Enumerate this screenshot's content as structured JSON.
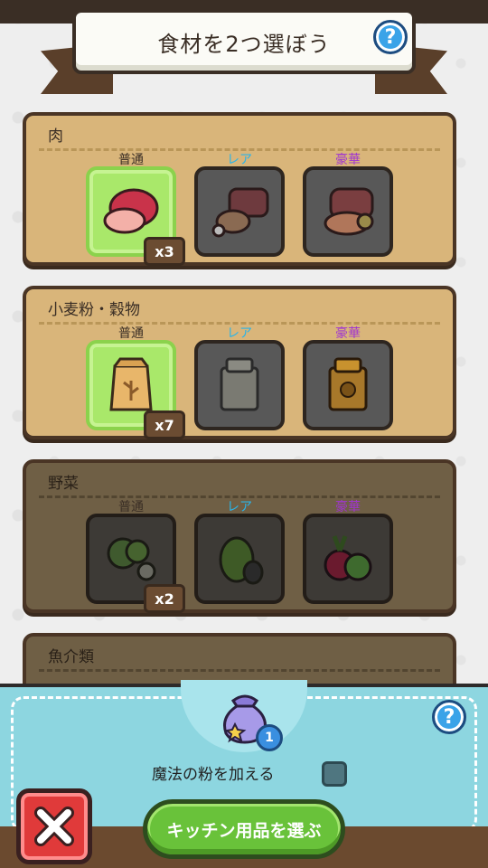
{
  "header": {
    "title": "食材を2つ選ぼう",
    "help_label": "?"
  },
  "tiers": {
    "normal": "普通",
    "rare": "レア",
    "luxury": "豪華"
  },
  "categories": [
    {
      "name": "肉",
      "normal_qty": "x3"
    },
    {
      "name": "小麦粉・穀物",
      "normal_qty": "x7"
    },
    {
      "name": "野菜",
      "normal_qty": "x2"
    },
    {
      "name": "魚介類"
    }
  ],
  "bottom": {
    "magic_label": "魔法の粉を加える",
    "magic_count": "1",
    "help_label": "?",
    "kitchen_button": "キッチン用品を選ぶ",
    "close_icon": "close-x-icon"
  },
  "colors": {
    "rare_tier": "#2bb4e8",
    "luxury_tier": "#a035d0",
    "selected_slot": "#a9e86a",
    "panel": "#8dd6e0"
  }
}
